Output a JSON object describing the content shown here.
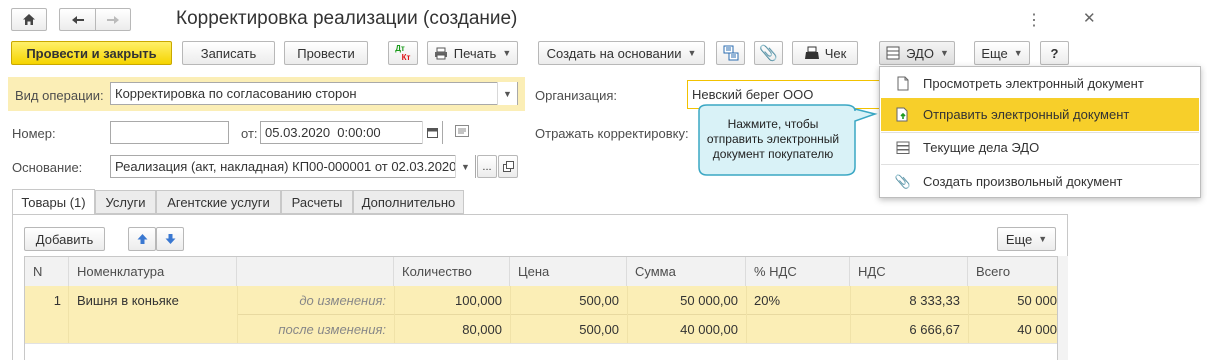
{
  "window": {
    "title": "Корректировка реализации (создание)"
  },
  "toolbar": {
    "post_close": "Провести и закрыть",
    "save": "Записать",
    "post": "Провести",
    "dt_kt_top": "Дт",
    "dt_kt_bottom": "Кт",
    "print": "Печать",
    "create_based": "Создать на основании",
    "receipt": "Чек",
    "edo": "ЭДО",
    "more": "Еще",
    "help": "?"
  },
  "form": {
    "op_type_label": "Вид операции:",
    "op_type_value": "Корректировка по согласованию сторон",
    "number_label": "Номер:",
    "number_value": "",
    "date_label": "от:",
    "date_value": "05.03.2020  0:00:00",
    "basis_label": "Основание:",
    "basis_value": "Реализация (акт, накладная) КП00-000001 от 02.03.2020",
    "org_label": "Организация:",
    "org_value": "Невский берег ООО",
    "reflect_label": "Отражать корректировку:"
  },
  "tooltip": {
    "text": "Нажмите, чтобы отправить электронный документ покупателю"
  },
  "edo_menu": {
    "items": [
      {
        "label": "Просмотреть электронный документ",
        "icon": "document-icon"
      },
      {
        "label": "Отправить электронный документ",
        "icon": "send-document-icon"
      },
      {
        "label": "Текущие дела ЭДО",
        "icon": "edo-tasks-icon"
      },
      {
        "label": "Создать произвольный документ",
        "icon": "paperclip-icon"
      }
    ],
    "highlight_color": "#f7cf2a"
  },
  "tabs": [
    "Товары (1)",
    "Услуги",
    "Агентские услуги",
    "Расчеты",
    "Дополнительно"
  ],
  "table_toolbar": {
    "add": "Добавить",
    "more": "Еще"
  },
  "table": {
    "columns": [
      "N",
      "Номенклатура",
      "",
      "Количество",
      "Цена",
      "Сумма",
      "% НДС",
      "НДС",
      "Всего"
    ],
    "row": {
      "n": "1",
      "item": "Вишня в коньяке",
      "before_label": "до изменения:",
      "after_label": "после изменения:",
      "before": {
        "qty": "100,000",
        "price": "500,00",
        "sum": "50 000,00",
        "vat_rate": "20%",
        "vat": "8 333,33",
        "total": "50 000"
      },
      "after": {
        "qty": "80,000",
        "price": "500,00",
        "sum": "40 000,00",
        "vat_rate": "",
        "vat": "6 666,67",
        "total": "40 000"
      }
    }
  },
  "colors": {
    "accent_yellow": "#f5d400",
    "row_highlight": "#fbeeb6",
    "tooltip_bg": "#d9f2f7",
    "tooltip_border": "#3aa7c4"
  }
}
